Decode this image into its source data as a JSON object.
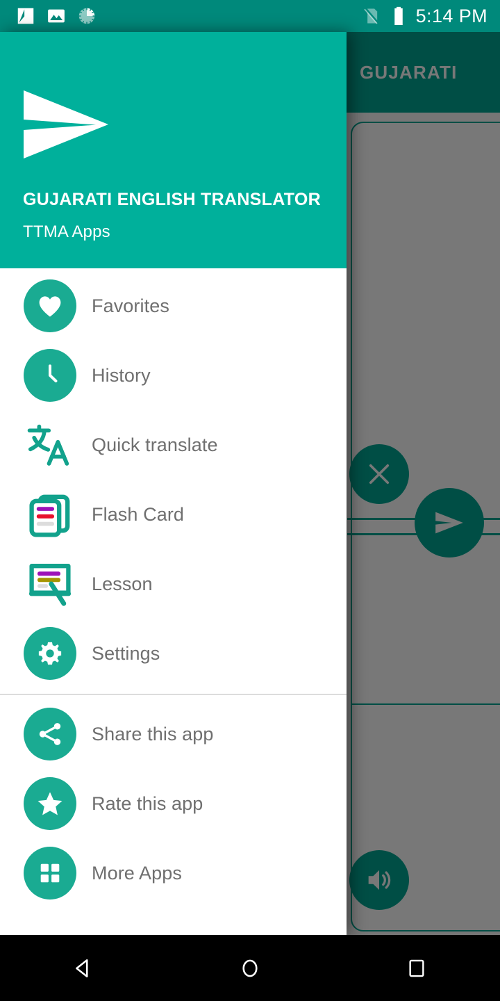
{
  "status_bar": {
    "time": "5:14 PM",
    "left_icons": [
      {
        "name": "screenshot-icon"
      },
      {
        "name": "photo-icon"
      },
      {
        "name": "sync-progress-icon"
      }
    ],
    "right_icons": [
      {
        "name": "no-sim-icon"
      },
      {
        "name": "battery-full-icon"
      }
    ],
    "background_color": "#00897b"
  },
  "background_app": {
    "appbar_title": "GUJARATI",
    "appbar_color": "#00a693",
    "buttons": [
      {
        "name": "clear-fab",
        "icon": "close-icon"
      },
      {
        "name": "translate-fab",
        "icon": "send-icon"
      },
      {
        "name": "speak-fab",
        "icon": "volume-up-icon"
      }
    ]
  },
  "drawer": {
    "header": {
      "logo_icon": "paper-plane-logo",
      "app_title": "GUJARATI ENGLISH TRANSLATOR",
      "app_subtitle": "TTMA Apps",
      "background_color": "#00b09b"
    },
    "primary_items": [
      {
        "label": "Favorites",
        "icon": "heart-icon",
        "style": "circle"
      },
      {
        "label": "History",
        "icon": "clock-icon",
        "style": "circle"
      },
      {
        "label": "Quick translate",
        "icon": "translate-icon",
        "style": "plain"
      },
      {
        "label": "Flash Card",
        "icon": "flash-card-icon",
        "style": "plain"
      },
      {
        "label": "Lesson",
        "icon": "lesson-icon",
        "style": "plain"
      },
      {
        "label": "Settings",
        "icon": "gear-icon",
        "style": "circle"
      }
    ],
    "secondary_items": [
      {
        "label": "Share this app",
        "icon": "share-icon",
        "style": "circle"
      },
      {
        "label": "Rate this app",
        "icon": "star-icon",
        "style": "circle"
      },
      {
        "label": "More Apps",
        "icon": "grid-apps-icon",
        "style": "circle"
      }
    ],
    "accent_color": "#1aab92",
    "label_color": "#6f6f6f"
  },
  "nav_bar": {
    "buttons": [
      {
        "name": "back-button",
        "icon": "back-triangle-icon"
      },
      {
        "name": "home-button",
        "icon": "home-circle-icon"
      },
      {
        "name": "recents-button",
        "icon": "recents-square-icon"
      }
    ],
    "background_color": "#000000"
  }
}
